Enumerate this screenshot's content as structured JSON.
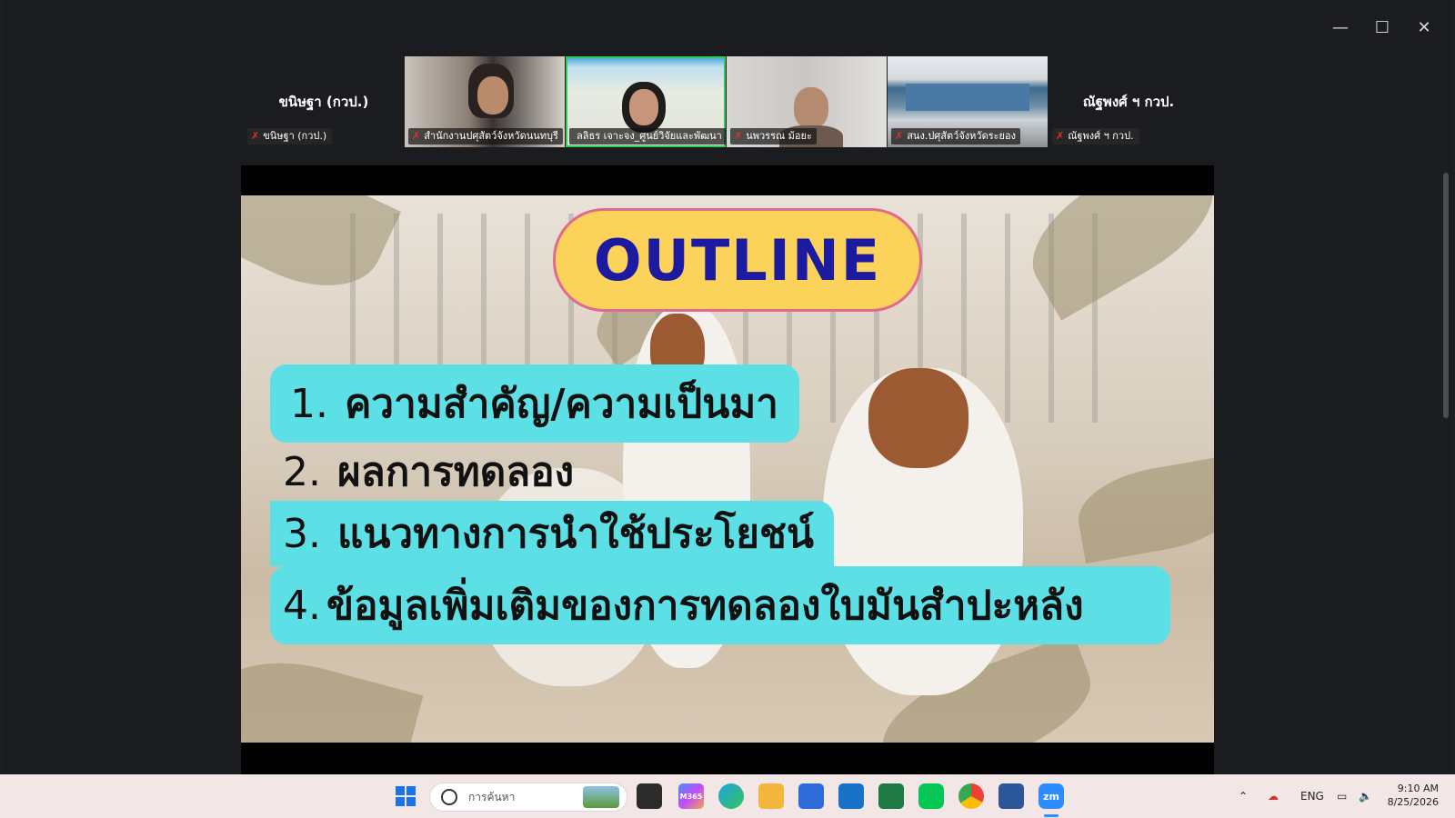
{
  "window": {
    "controls": {
      "minimize": "—",
      "maximize": "☐",
      "close": "✕"
    }
  },
  "gallery": {
    "left_name_big": "ขนิษฐา (กวป.)",
    "left_name_small": "ขนิษฐา (กวป.)",
    "tiles": [
      {
        "label": "สำนักงานปศุสัตว์จังหวัดนนทบุรี"
      },
      {
        "label": "ลลิธร เจาะจง_ศูนย์วิจัยและพัฒนา"
      },
      {
        "label": "นพวรรณ ม้อยะ"
      },
      {
        "label": "สนง.ปศุสัตว์จังหวัดระยอง"
      }
    ],
    "right_name_big": "ณัฐพงศ์ ฯ กวป.",
    "right_name_small": "ณัฐพงศ์ ฯ กวป."
  },
  "slide": {
    "title": "OUTLINE",
    "items": [
      {
        "num": "1.",
        "text": "ความสำคัญ/ความเป็นมา"
      },
      {
        "num": "2.",
        "text": "ผลการทดลอง"
      },
      {
        "num": "3.",
        "text": "แนวทางการนำใช้ประโยชน์"
      },
      {
        "num": "4.",
        "text": "ข้อมูลเพิ่มเติมของการทดลองใบมันสำปะหลัง"
      }
    ]
  },
  "taskbar": {
    "search_placeholder": "การค้นหา",
    "lang": "ENG",
    "time": "9:10 AM",
    "date": "8/25/2026",
    "m365_label": "M365",
    "zoom_label": "zm"
  }
}
